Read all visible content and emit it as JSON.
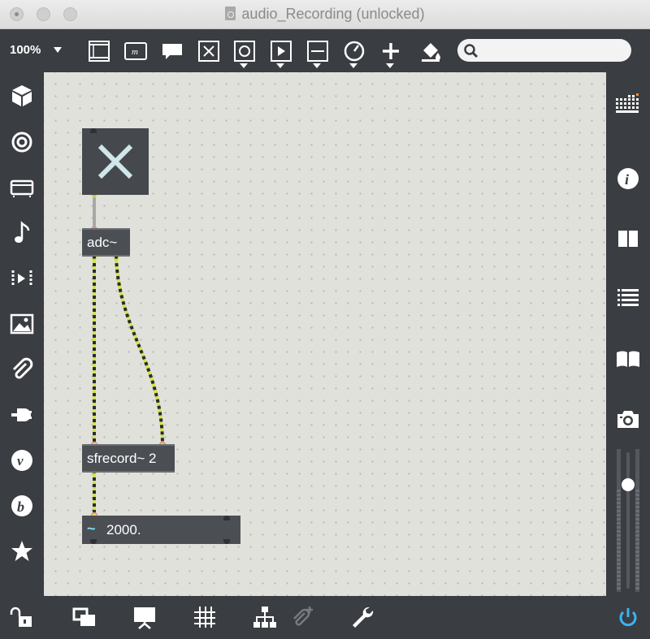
{
  "window": {
    "title": "audio_Recording (unlocked)",
    "icons": [
      "close-button",
      "minimize-button",
      "zoom-button",
      "document-icon"
    ]
  },
  "toolbar": {
    "zoom_level": "100%",
    "search": {
      "value": "",
      "placeholder": ""
    },
    "buttons": [
      "new-object",
      "message",
      "comment",
      "toggle",
      "button",
      "play",
      "slider",
      "dial",
      "plus",
      "paint-bucket"
    ]
  },
  "left_sidebar": {
    "icons": [
      "cube-icon",
      "target-icon",
      "console-icon",
      "music-note-icon",
      "media-icon",
      "image-icon",
      "paperclip-icon",
      "plug-icon",
      "vizzie-icon",
      "beap-icon",
      "star-icon"
    ]
  },
  "right_sidebar": {
    "icons": [
      "grid-mixer-icon",
      "info-icon",
      "split-view-icon",
      "list-icon",
      "book-icon",
      "camera-icon"
    ],
    "volume_level": 0.75,
    "accent": "#f28c28"
  },
  "patcher": {
    "toggle_state": "off",
    "objects": [
      {
        "id": "adc",
        "text": "adc~"
      },
      {
        "id": "sfrecord",
        "text": "sfrecord~ 2"
      }
    ],
    "number_box": {
      "prefix": "~",
      "value": "2000."
    },
    "cord_colors": {
      "control": "#a8a8a8",
      "signal": "#d4e34a",
      "signal_dash": "#2b2b2b"
    }
  },
  "bottom_toolbar": {
    "icons": [
      "lock-icon",
      "windows-icon",
      "presentation-icon",
      "grid-icon",
      "hierarchy-icon",
      "add-dependency-icon",
      "wrench-icon",
      "power-icon"
    ],
    "power_color": "#3ab4f2"
  }
}
